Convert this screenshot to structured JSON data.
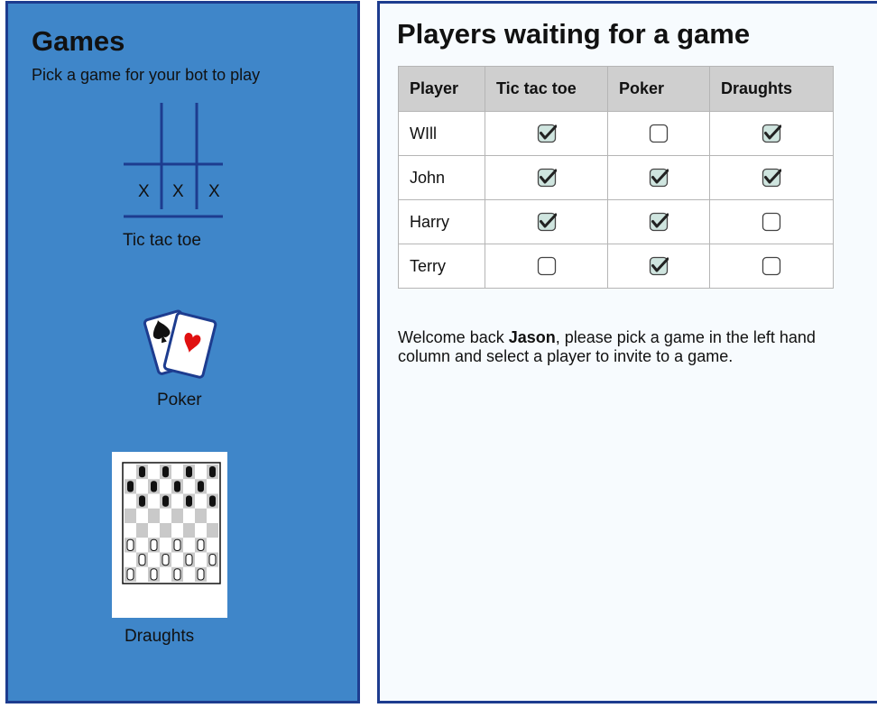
{
  "games_panel": {
    "title": "Games",
    "subtitle": "Pick a game for your bot to play",
    "games": [
      {
        "label": "Tic tac toe",
        "icon": "tic-tac-toe-board-icon",
        "marks": [
          "X",
          "X",
          "X"
        ]
      },
      {
        "label": "Poker",
        "icon": "playing-cards-icon"
      },
      {
        "label": "Draughts",
        "icon": "draughts-board-icon"
      }
    ]
  },
  "players_panel": {
    "title": "Players waiting for a game",
    "table": {
      "headers": [
        "Player",
        "Tic tac toe",
        "Poker",
        "Draughts"
      ],
      "rows": [
        {
          "name": "WIll",
          "ttt": true,
          "poker": false,
          "draughts": true
        },
        {
          "name": "John",
          "ttt": true,
          "poker": true,
          "draughts": true
        },
        {
          "name": "Harry",
          "ttt": true,
          "poker": true,
          "draughts": false
        },
        {
          "name": "Terry",
          "ttt": false,
          "poker": true,
          "draughts": false
        }
      ]
    },
    "welcome": {
      "prefix": "Welcome back ",
      "user": "Jason",
      "suffix": ", please pick a game in the left hand column and select a player to invite to a game."
    }
  },
  "colors": {
    "games_panel_bg": "#3f86c9",
    "panel_border": "#1d3c8f",
    "table_header_bg": "#cfcfcf",
    "checkbox_checked_fill": "#cfe5df",
    "checkmark": "#222222"
  }
}
